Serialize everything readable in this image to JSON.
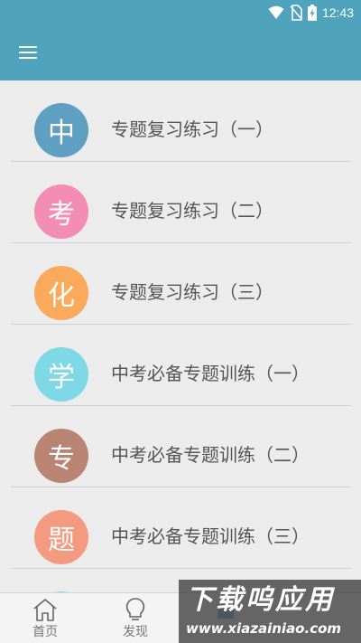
{
  "status": {
    "time": "12:43"
  },
  "appbar": {
    "menu_icon": "hamburger-menu-icon",
    "color": "#4fa3bd"
  },
  "list": {
    "items": [
      {
        "badge": "中",
        "label": "专题复习练习（一）",
        "color": "#5f9fc2"
      },
      {
        "badge": "考",
        "label": "专题复习练习（二）",
        "color": "#f48db4"
      },
      {
        "badge": "化",
        "label": "专题复习练习（三）",
        "color": "#fbaa5c"
      },
      {
        "badge": "学",
        "label": "中考必备专题训练（一）",
        "color": "#7ed8e5"
      },
      {
        "badge": "专",
        "label": "中考必备专题训练（二）",
        "color": "#b98473"
      },
      {
        "badge": "题",
        "label": "中考必备专题训练（三）",
        "color": "#f49a80"
      }
    ]
  },
  "tabs": [
    {
      "label": "首页",
      "icon": "home-icon"
    },
    {
      "label": "发现",
      "icon": "lightbulb-icon"
    },
    {
      "label": "",
      "icon": "hidden-icon"
    }
  ],
  "watermark": {
    "title": "下载呜应用",
    "url": "www.xiazainiao.com"
  }
}
